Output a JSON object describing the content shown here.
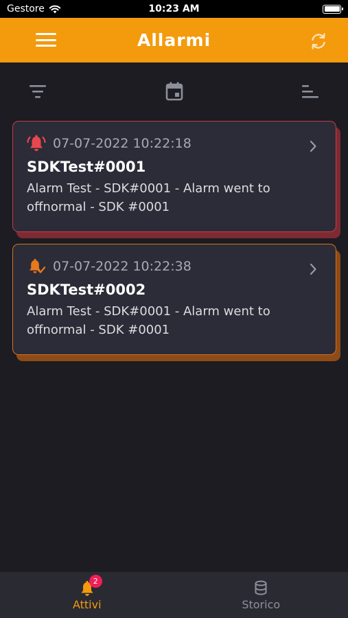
{
  "status_bar": {
    "carrier": "Gestore",
    "time": "10:23 AM"
  },
  "header": {
    "title": "Allarmi"
  },
  "alarms": [
    {
      "date": "07-07-2022 10:22:18",
      "title": "SDKTest#0001",
      "description": "Alarm Test - SDK#0001 - Alarm went to offnormal - SDK #0001",
      "color": "#c63b46",
      "icon": "bell-ringing-icon"
    },
    {
      "date": "07-07-2022 10:22:38",
      "title": "SDKTest#0002",
      "description": "Alarm Test - SDK#0001 - Alarm went to offnormal - SDK #0001",
      "color": "#d9711e",
      "icon": "bell-acknowledged-icon"
    }
  ],
  "tabbar": {
    "tabs": [
      {
        "label": "Attivi",
        "badge": "2",
        "active": true
      },
      {
        "label": "Storico",
        "active": false
      }
    ]
  },
  "colors": {
    "accent": "#f39a0d",
    "background": "#1c1c22",
    "card": "#2b2c37",
    "badge": "#f01e57"
  }
}
